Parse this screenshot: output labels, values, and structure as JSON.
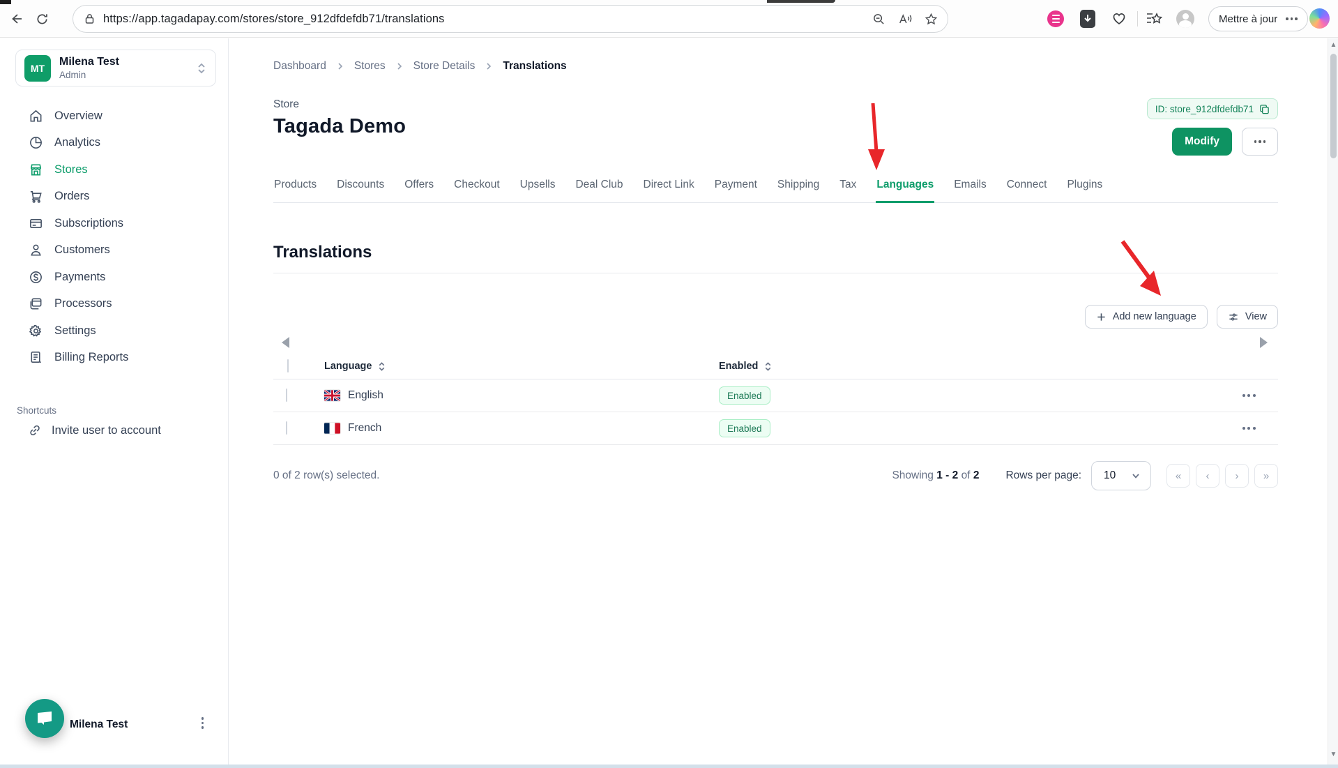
{
  "browser": {
    "url": "https://app.tagadapay.com/stores/store_912dfdefdb71/translations",
    "update_label": "Mettre à jour"
  },
  "sidebar": {
    "account": {
      "initials": "MT",
      "name": "Milena Test",
      "role": "Admin"
    },
    "items": [
      {
        "label": "Overview"
      },
      {
        "label": "Analytics"
      },
      {
        "label": "Stores",
        "active": true
      },
      {
        "label": "Orders"
      },
      {
        "label": "Subscriptions"
      },
      {
        "label": "Customers"
      },
      {
        "label": "Payments"
      },
      {
        "label": "Processors"
      },
      {
        "label": "Settings"
      },
      {
        "label": "Billing Reports"
      }
    ],
    "shortcuts_label": "Shortcuts",
    "invite_label": "Invite user to account",
    "footer_name": "Milena Test"
  },
  "breadcrumb": {
    "items": [
      "Dashboard",
      "Stores",
      "Store Details",
      "Translations"
    ]
  },
  "store": {
    "section_label": "Store",
    "name": "Tagada Demo",
    "id_badge": "ID: store_912dfdefdb71",
    "modify_label": "Modify"
  },
  "tabs": {
    "items": [
      "Products",
      "Discounts",
      "Offers",
      "Checkout",
      "Upsells",
      "Deal Club",
      "Direct Link",
      "Payment",
      "Shipping",
      "Tax",
      "Languages",
      "Emails",
      "Connect",
      "Plugins"
    ],
    "active": "Languages"
  },
  "translations": {
    "title": "Translations",
    "add_button_label": "Add new language",
    "view_button_label": "View",
    "table": {
      "columns": {
        "language": "Language",
        "enabled": "Enabled"
      },
      "rows": [
        {
          "language": "English",
          "flag": "united-kingdom",
          "status": "Enabled"
        },
        {
          "language": "French",
          "flag": "france",
          "status": "Enabled"
        }
      ]
    },
    "footer": {
      "selected_text": "0 of 2 row(s) selected.",
      "showing_label": "Showing",
      "showing_range": "1 - 2",
      "of_label": "of",
      "total": "2",
      "rows_per_page_label": "Rows per page:",
      "rows_per_page_value": "10",
      "pagination": {
        "first": "«",
        "prev": "‹",
        "next": "›",
        "last": "»"
      }
    }
  },
  "colors": {
    "accent_green": "#0e9d6b",
    "modify_green": "#0e9362",
    "badge_bg": "#ecfdf3",
    "badge_border": "#aaeec6",
    "badge_text": "#1d7a56",
    "annotation_red": "#e8262a",
    "chat_teal": "#149a85"
  }
}
